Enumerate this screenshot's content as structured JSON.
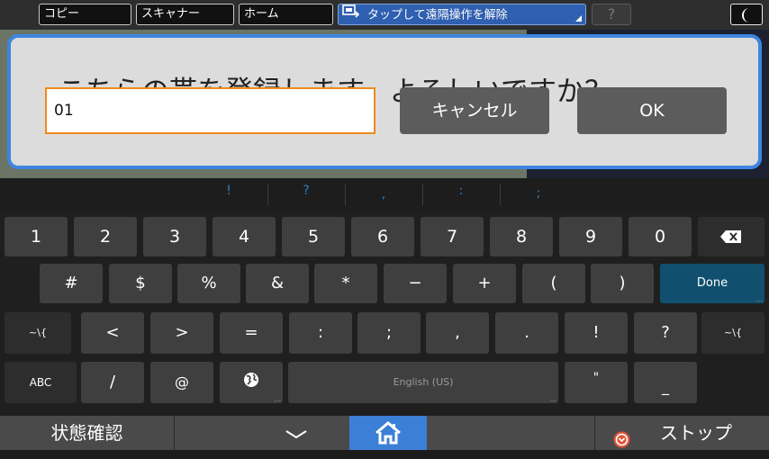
{
  "topbar": {
    "copy": "コピー",
    "scanner": "スキャナー",
    "home": "ホーム",
    "remote": "タップして遠隔操作を解除",
    "help": "?"
  },
  "dialog": {
    "message": "こちらの帯を登録します。よろしいですか？",
    "input_value": "01",
    "cancel": "キャンセル",
    "ok": "OK"
  },
  "suggestions": [
    "!",
    "?",
    ",",
    ":",
    ";"
  ],
  "keyboard": {
    "row1": [
      "1",
      "2",
      "3",
      "4",
      "5",
      "6",
      "7",
      "8",
      "9",
      "0"
    ],
    "row2": [
      "#",
      "$",
      "%",
      "&",
      "*",
      "−",
      "+",
      "(",
      ")"
    ],
    "done": "Done",
    "row3": [
      "~\\{",
      "<",
      ">",
      "=",
      ":",
      ";",
      ",",
      ".",
      "!",
      "?",
      "~\\{"
    ],
    "row4": {
      "abc": "ABC",
      "slash": "/",
      "at": "@",
      "space": "English (US)",
      "quote": "\"",
      "underscore": "_"
    }
  },
  "bottombar": {
    "status": "状態確認",
    "stop": "ストップ"
  },
  "colors": {
    "accent": "#3d86e0",
    "input_border": "#f08a1c",
    "done_key": "#10506e",
    "suggest_text": "#2e7fc4",
    "home_button": "#3b7fd6"
  },
  "icons": [
    "remote-control-icon",
    "moon-icon",
    "backspace-icon",
    "globe-icon",
    "chevron-down-icon",
    "home-icon",
    "stop-icon"
  ]
}
